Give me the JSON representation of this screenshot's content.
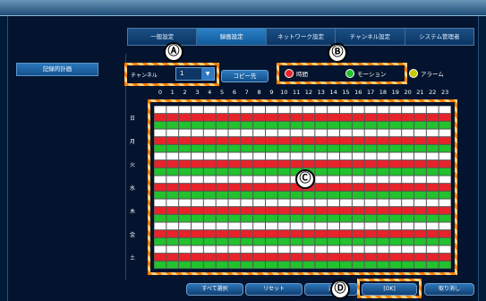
{
  "tabs": [
    "一般設定",
    "録画設定",
    "ネットワーク設定",
    "チャンネル設定",
    "システム管理者"
  ],
  "active_tab": 1,
  "sidebar": {
    "item": "記録的計画"
  },
  "channel": {
    "label": "チャンネル",
    "value": "1"
  },
  "copy_button": "コピー先",
  "legend": [
    {
      "label": "時間",
      "color": "#e8232a"
    },
    {
      "label": "モーション",
      "color": "#22c12e"
    },
    {
      "label": "アラーム",
      "color": "#c7c700"
    }
  ],
  "hours": [
    "0",
    "1",
    "2",
    "3",
    "4",
    "5",
    "6",
    "7",
    "8",
    "9",
    "10",
    "11",
    "12",
    "13",
    "14",
    "15",
    "16",
    "17",
    "18",
    "19",
    "20",
    "21",
    "22",
    "23"
  ],
  "days": [
    "日",
    "月",
    "火",
    "水",
    "木",
    "金",
    "土"
  ],
  "schedule": {
    "row_pattern": [
      "white",
      "red",
      "green"
    ],
    "colors": {
      "white": "#ffffff",
      "red": "#e8232a",
      "green": "#22c12e"
    }
  },
  "buttons": {
    "select_all": "すべて選択",
    "reset": "リセット",
    "apply": "適",
    "ok": "[OK]",
    "cancel": "取り消し"
  },
  "annotations": [
    "Ⓐ",
    "Ⓑ",
    "Ⓒ",
    "Ⓓ"
  ]
}
